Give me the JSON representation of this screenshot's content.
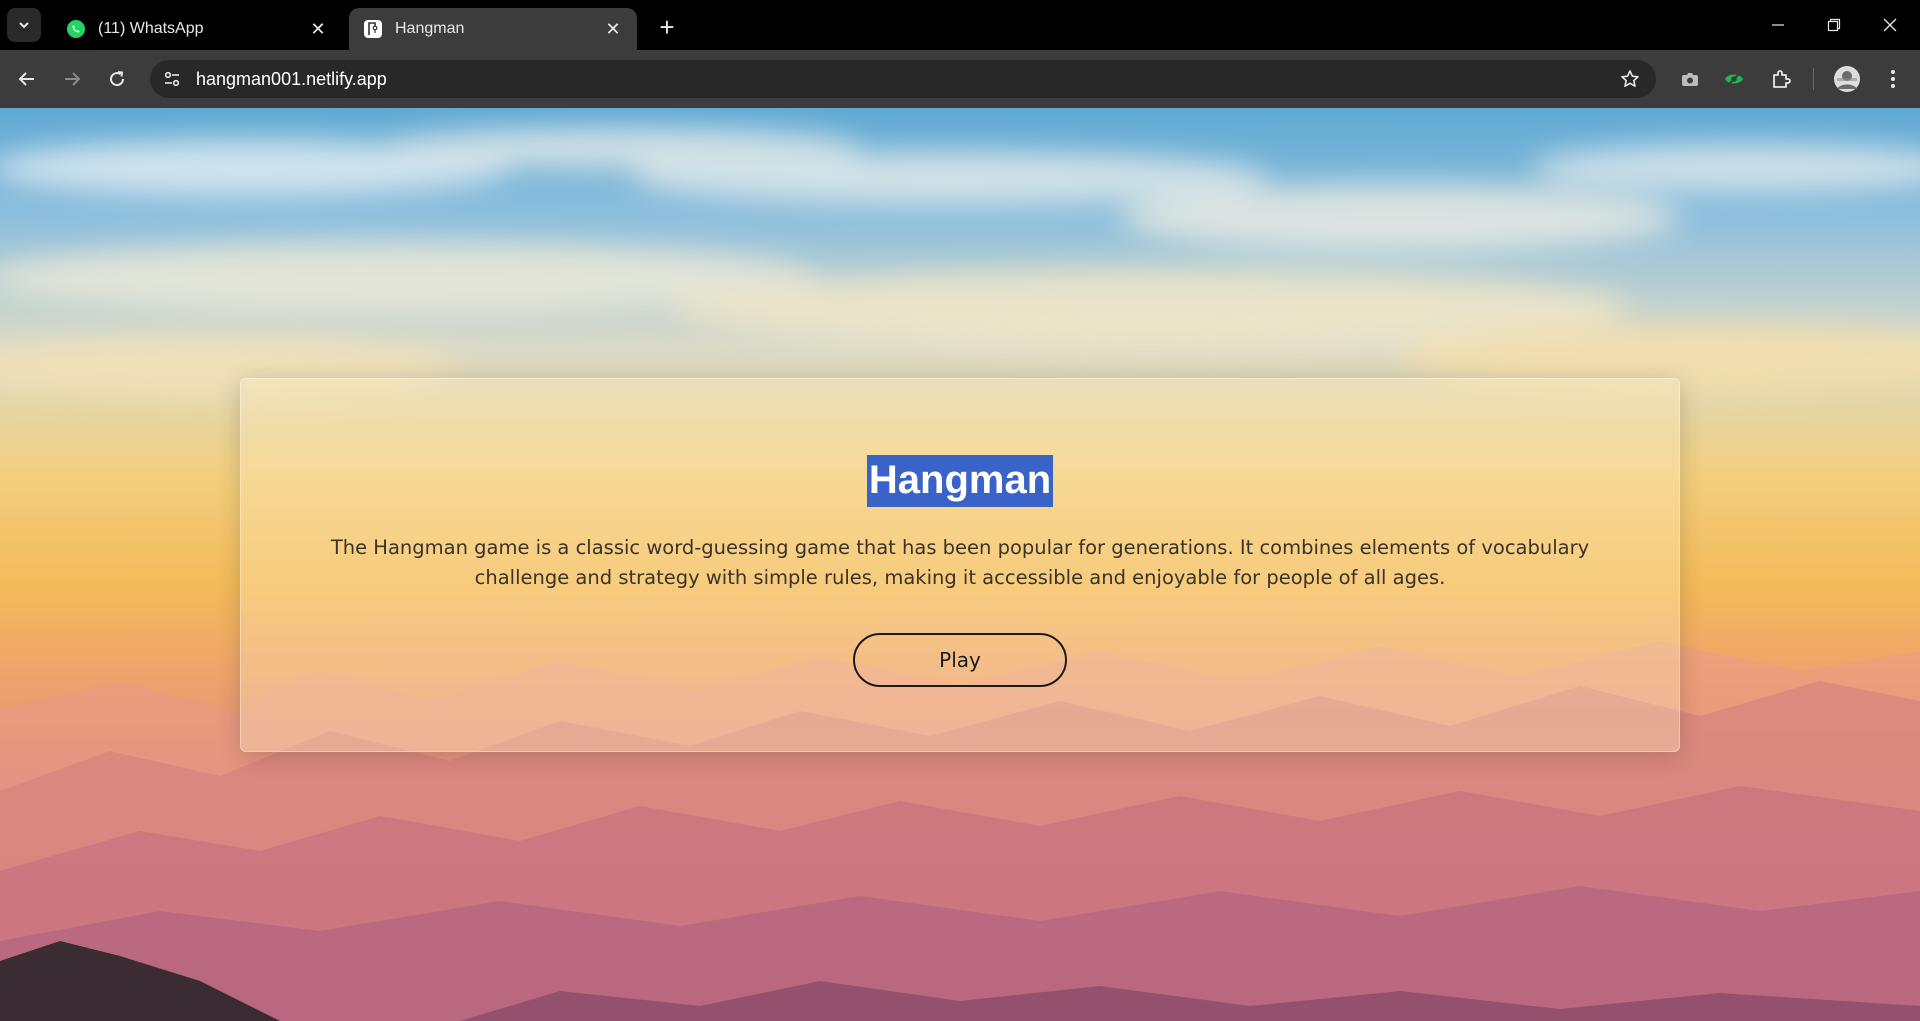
{
  "browser": {
    "tabs": [
      {
        "title": "(11) WhatsApp",
        "icon": "whatsapp-icon",
        "active": false
      },
      {
        "title": "Hangman",
        "icon": "hangman-favicon-icon",
        "active": true
      }
    ],
    "new_tab_symbol": "+",
    "close_symbol": "✕",
    "url": "hangman001.netlify.app"
  },
  "page": {
    "title": "Hangman",
    "description": "The Hangman game is a classic word-guessing game that has been popular for generations. It combines elements of vocabulary challenge and strategy with simple rules, making it accessible and enjoyable for people of all ages.",
    "play_label": "Play"
  },
  "colors": {
    "title_highlight": "#3a63c9",
    "chrome_dark": "#000000",
    "toolbar": "#3c3c3c",
    "omnibox": "#282828",
    "whatsapp_green": "#25d366",
    "extension_green": "#1fb84a"
  }
}
